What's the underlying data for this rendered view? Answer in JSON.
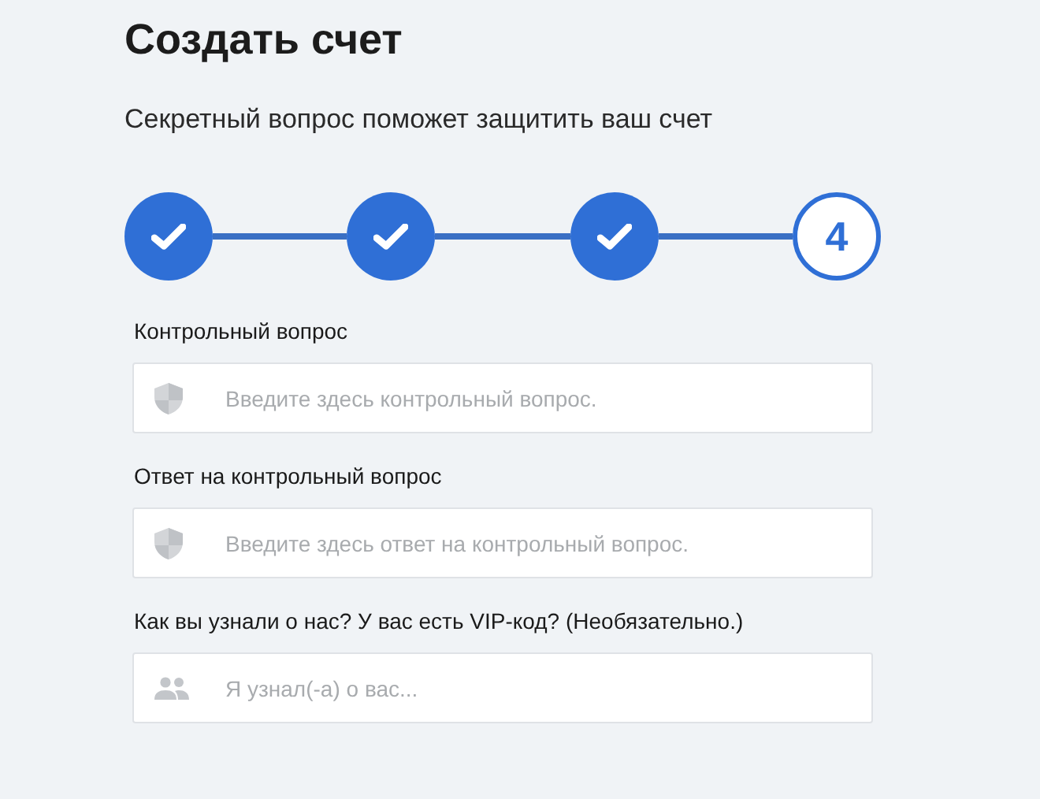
{
  "title": "Создать счет",
  "subtitle": "Секретный вопрос поможет защитить ваш счет",
  "steps": [
    {
      "done": true
    },
    {
      "done": true
    },
    {
      "done": true
    },
    {
      "done": false,
      "label": "4"
    }
  ],
  "fields": [
    {
      "label": "Контрольный вопрос",
      "placeholder": "Введите здесь контрольный вопрос.",
      "kind": "shield"
    },
    {
      "label": "Ответ на контрольный вопрос",
      "placeholder": "Введите здесь ответ на контрольный вопрос.",
      "kind": "shield"
    },
    {
      "label": "Как вы узнали о нас? У вас есть VIP-код? (Необязательно.)",
      "placeholder": "Я узнал(-а) о вас...",
      "kind": "people"
    }
  ]
}
